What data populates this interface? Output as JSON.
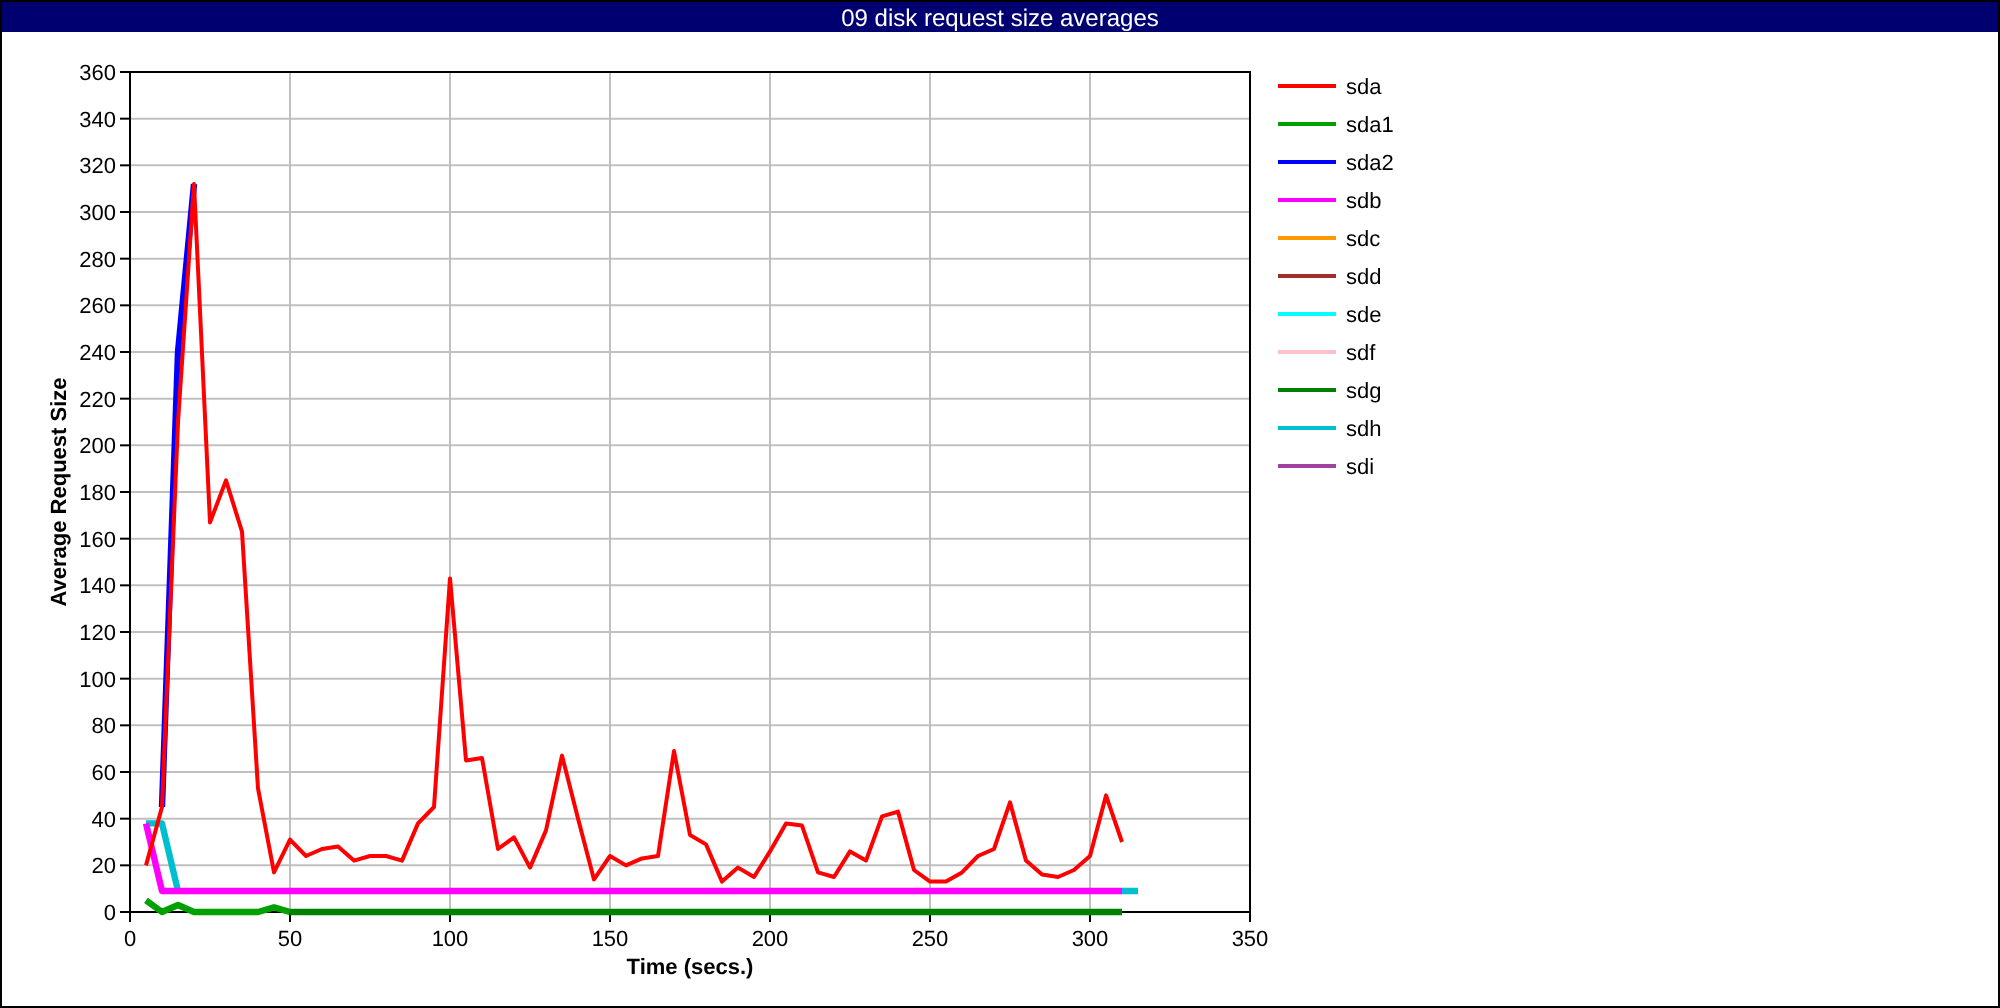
{
  "window": {
    "title": "09 disk request size averages"
  },
  "chart_data": {
    "type": "line",
    "xlabel": "Time (secs.)",
    "ylabel": "Average Request Size",
    "grid": true,
    "legend": true,
    "x": [
      5,
      10,
      15,
      20,
      25,
      30,
      35,
      40,
      45,
      50,
      55,
      60,
      65,
      70,
      75,
      80,
      85,
      90,
      95,
      100,
      105,
      110,
      115,
      120,
      125,
      130,
      135,
      140,
      145,
      150,
      155,
      160,
      165,
      170,
      175,
      180,
      185,
      190,
      195,
      200,
      205,
      210,
      215,
      220,
      225,
      230,
      235,
      240,
      245,
      250,
      255,
      260,
      265,
      270,
      275,
      280,
      285,
      290,
      295,
      300,
      305,
      310,
      315
    ],
    "xlim": [
      0,
      350
    ],
    "ylim": [
      0,
      360
    ],
    "xticks": [
      0,
      50,
      100,
      150,
      200,
      250,
      300,
      350
    ],
    "yticks": [
      0,
      20,
      40,
      60,
      80,
      100,
      120,
      140,
      160,
      180,
      200,
      220,
      240,
      260,
      280,
      300,
      320,
      340,
      360
    ],
    "series": [
      {
        "name": "sda",
        "color": "#ff0000",
        "values": [
          20,
          45,
          210,
          312,
          167,
          185,
          163,
          53,
          17,
          31,
          24,
          27,
          28,
          22,
          24,
          24,
          22,
          38,
          45,
          143,
          65,
          66,
          27,
          32,
          19,
          35,
          67,
          40,
          14,
          24,
          20,
          23,
          24,
          69,
          33,
          29,
          13,
          19,
          15,
          26,
          38,
          37,
          17,
          15,
          26,
          22,
          41,
          43,
          18,
          13,
          13,
          17,
          24,
          27,
          47,
          22,
          16,
          15,
          18,
          24,
          50,
          30,
          null
        ]
      },
      {
        "name": "sda1",
        "color": "#00a000",
        "values": [
          5,
          0,
          3,
          0,
          0,
          0,
          0,
          0,
          2,
          0,
          null,
          null,
          null,
          null,
          null,
          null,
          null,
          null,
          null,
          null,
          null,
          null,
          null,
          null,
          null,
          null,
          null,
          null,
          null,
          null,
          null,
          null,
          null,
          null,
          null,
          null,
          null,
          null,
          null,
          null,
          null,
          null,
          null,
          null,
          null,
          null,
          null,
          null,
          null,
          null,
          null,
          null,
          null,
          null,
          null,
          null,
          null,
          null,
          null,
          null,
          null,
          null,
          null
        ]
      },
      {
        "name": "sda2",
        "color": "#0000ff",
        "values": [
          null,
          45,
          240,
          312,
          null,
          null,
          null,
          null,
          null,
          null,
          null,
          null,
          null,
          null,
          null,
          null,
          null,
          null,
          null,
          null,
          null,
          null,
          null,
          null,
          null,
          null,
          null,
          null,
          null,
          null,
          null,
          null,
          null,
          null,
          null,
          null,
          null,
          null,
          null,
          null,
          null,
          null,
          null,
          null,
          null,
          null,
          null,
          null,
          null,
          null,
          null,
          null,
          null,
          null,
          null,
          null,
          null,
          null,
          null,
          null,
          null,
          null,
          null
        ]
      },
      {
        "name": "sdb",
        "color": "#ff00ff",
        "values": [
          38,
          9,
          9,
          9,
          9,
          9,
          9,
          9,
          9,
          9,
          9,
          9,
          9,
          9,
          9,
          9,
          9,
          9,
          9,
          9,
          9,
          9,
          9,
          9,
          9,
          9,
          9,
          9,
          9,
          9,
          9,
          9,
          9,
          9,
          9,
          9,
          9,
          9,
          9,
          9,
          9,
          9,
          9,
          9,
          9,
          9,
          9,
          9,
          9,
          9,
          9,
          9,
          9,
          9,
          9,
          9,
          9,
          9,
          9,
          9,
          9,
          9,
          null
        ]
      },
      {
        "name": "sdc",
        "color": "#ff9900",
        "values": [
          null,
          null,
          null,
          null,
          null,
          null,
          null,
          null,
          null,
          null,
          null,
          null,
          null,
          null,
          null,
          null,
          null,
          null,
          null,
          null,
          null,
          null,
          null,
          null,
          null,
          null,
          null,
          null,
          null,
          null,
          null,
          null,
          null,
          null,
          null,
          null,
          null,
          null,
          null,
          null,
          null,
          null,
          null,
          null,
          null,
          null,
          null,
          null,
          null,
          null,
          null,
          null,
          null,
          null,
          null,
          null,
          null,
          null,
          null,
          null,
          null,
          null,
          null
        ]
      },
      {
        "name": "sdd",
        "color": "#a52a2a",
        "values": [
          null,
          null,
          null,
          null,
          null,
          null,
          null,
          null,
          null,
          null,
          null,
          null,
          null,
          null,
          null,
          null,
          null,
          null,
          null,
          null,
          null,
          null,
          null,
          null,
          null,
          null,
          null,
          null,
          null,
          null,
          null,
          null,
          null,
          null,
          null,
          null,
          null,
          null,
          null,
          null,
          null,
          null,
          null,
          null,
          null,
          null,
          null,
          null,
          null,
          null,
          null,
          null,
          null,
          null,
          null,
          null,
          null,
          null,
          null,
          null,
          null,
          null,
          null
        ]
      },
      {
        "name": "sde",
        "color": "#00ffff",
        "values": [
          null,
          null,
          null,
          null,
          null,
          null,
          null,
          null,
          null,
          null,
          null,
          null,
          null,
          null,
          null,
          null,
          null,
          null,
          null,
          null,
          null,
          null,
          null,
          null,
          null,
          null,
          null,
          null,
          null,
          null,
          null,
          null,
          null,
          null,
          null,
          null,
          null,
          null,
          null,
          null,
          null,
          null,
          null,
          null,
          null,
          null,
          null,
          null,
          null,
          null,
          null,
          null,
          null,
          null,
          null,
          null,
          null,
          null,
          null,
          null,
          null,
          null,
          null
        ]
      },
      {
        "name": "sdf",
        "color": "#ffc0cb",
        "values": [
          null,
          null,
          null,
          null,
          null,
          null,
          null,
          null,
          null,
          null,
          null,
          null,
          null,
          null,
          null,
          null,
          null,
          null,
          null,
          null,
          null,
          null,
          null,
          null,
          null,
          null,
          null,
          null,
          null,
          null,
          null,
          null,
          null,
          null,
          null,
          null,
          null,
          null,
          null,
          null,
          null,
          null,
          null,
          null,
          null,
          null,
          null,
          null,
          null,
          null,
          null,
          null,
          null,
          null,
          null,
          null,
          null,
          null,
          null,
          null,
          null,
          null,
          null
        ]
      },
      {
        "name": "sdg",
        "color": "#008000",
        "values": [
          null,
          null,
          null,
          null,
          null,
          null,
          null,
          null,
          null,
          0,
          0,
          0,
          0,
          0,
          0,
          0,
          0,
          0,
          0,
          0,
          0,
          0,
          0,
          0,
          0,
          0,
          0,
          0,
          0,
          0,
          0,
          0,
          0,
          0,
          0,
          0,
          0,
          0,
          0,
          0,
          0,
          0,
          0,
          0,
          0,
          0,
          0,
          0,
          0,
          0,
          0,
          0,
          0,
          0,
          0,
          0,
          0,
          0,
          0,
          0,
          0,
          0,
          null
        ]
      },
      {
        "name": "sdh",
        "color": "#00c0d0",
        "values": [
          38,
          38,
          9,
          null,
          null,
          null,
          null,
          null,
          null,
          null,
          null,
          null,
          null,
          null,
          null,
          null,
          null,
          null,
          null,
          null,
          null,
          null,
          null,
          null,
          null,
          null,
          null,
          null,
          null,
          null,
          null,
          null,
          null,
          null,
          null,
          null,
          null,
          null,
          null,
          null,
          null,
          null,
          null,
          null,
          null,
          null,
          null,
          null,
          null,
          null,
          null,
          null,
          null,
          null,
          null,
          null,
          null,
          null,
          null,
          null,
          null,
          9,
          9
        ]
      },
      {
        "name": "sdi",
        "color": "#a040a0",
        "values": [
          null,
          null,
          null,
          null,
          null,
          null,
          null,
          null,
          null,
          null,
          null,
          null,
          null,
          null,
          null,
          null,
          null,
          null,
          null,
          null,
          null,
          null,
          null,
          null,
          null,
          null,
          null,
          null,
          null,
          null,
          null,
          null,
          null,
          null,
          null,
          null,
          null,
          null,
          null,
          null,
          null,
          null,
          null,
          null,
          null,
          null,
          null,
          null,
          null,
          null,
          null,
          null,
          null,
          null,
          null,
          null,
          null,
          null,
          null,
          null,
          null,
          null,
          null
        ]
      }
    ]
  }
}
